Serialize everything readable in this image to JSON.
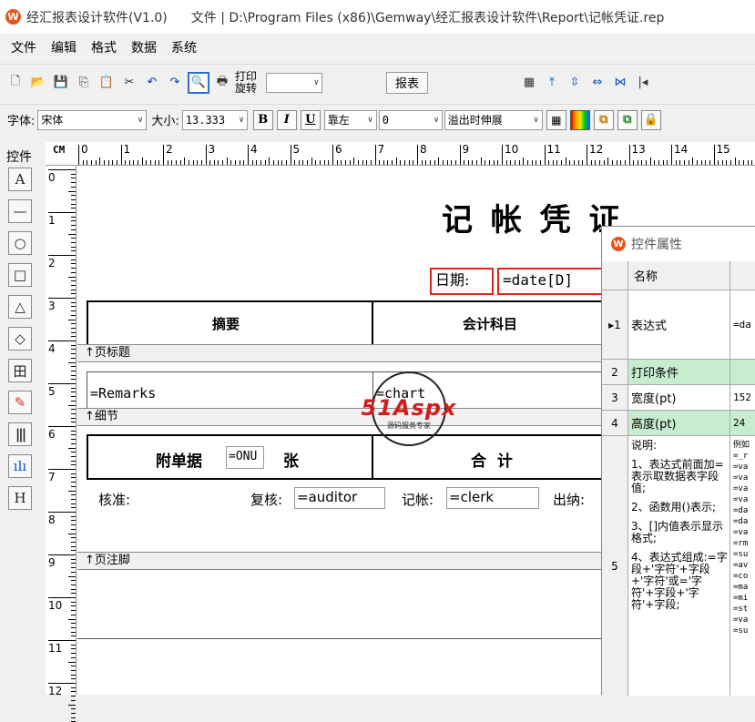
{
  "titlebar": {
    "app_name": "经汇报表设计软件(V1.0)",
    "file_label": "文件 | D:\\Program Files (x86)\\Gemway\\经汇报表设计软件\\Report\\记帐凭证.rep",
    "icon_text": "W"
  },
  "menu": [
    "文件",
    "编辑",
    "格式",
    "数据",
    "系统"
  ],
  "toolbar1": {
    "print_rotate_label": "打印旋转",
    "report_button": "报表",
    "combo_value": ""
  },
  "toolbar2": {
    "font_label": "字体:",
    "font_value": "宋体",
    "size_label": "大小:",
    "size_value": "13.333",
    "bold": "B",
    "italic": "I",
    "underline": "U",
    "align_value": "靠左",
    "indent_value": "0",
    "overflow_value": "溢出时伸展"
  },
  "palette": {
    "title": "控件",
    "items": [
      "A",
      "—",
      "○",
      "□",
      "△",
      "◇",
      "田",
      "✎",
      "|||",
      "ılı",
      "H"
    ]
  },
  "ruler": {
    "unit": "CM",
    "h_numbers": [
      "0",
      "1",
      "2",
      "3",
      "4",
      "5",
      "6",
      "7",
      "8",
      "9",
      "10",
      "11",
      "12",
      "13",
      "14",
      "15"
    ],
    "v_numbers": [
      "0",
      "1",
      "2",
      "3",
      "4",
      "5",
      "6",
      "7",
      "8",
      "9",
      "10",
      "11",
      "12"
    ]
  },
  "report": {
    "title": "记 帐 凭 证",
    "date_label": "日期:",
    "date_field": "=date[D]",
    "col_summary": "摘要",
    "col_account": "会计科目",
    "band_page_header": "↑页标题",
    "remarks_field": "=Remarks",
    "chart_field": "=chart",
    "band_detail": "↑细节",
    "attach_label": "附单据",
    "attach_field": "=ONU",
    "attach_unit": "张",
    "total_label": "合  计",
    "approve_label": "核准:",
    "review_label": "复核:",
    "auditor_field": "=auditor",
    "bookkeep_label": "记帐:",
    "clerk_field": "=clerk",
    "cashier_label": "出纳:",
    "band_page_footer": "↑页注脚"
  },
  "watermark": {
    "brand": "51Aspx",
    "sub": "源码服务专家"
  },
  "props": {
    "title": "控件属性",
    "header_name": "名称",
    "rows": [
      {
        "idx": "▸1",
        "name": "表达式",
        "value": "=da"
      },
      {
        "idx": "2",
        "name": "打印条件",
        "value": ""
      },
      {
        "idx": "3",
        "name": "宽度(pt)",
        "value": "152"
      },
      {
        "idx": "4",
        "name": "高度(pt)",
        "value": "24"
      }
    ],
    "desc_idx": "5",
    "desc_lines": [
      "说明:",
      "1、表达式前面加=表示取数据表字段值;",
      "2、函数用()表示;",
      "3、[]内值表示显示格式;",
      "4、表达式组成:=字段+'字符'+字段+'字符'或='字符'+字段+'字符'+字段;"
    ],
    "desc_values": [
      "例如",
      "=_r",
      "=va",
      "=va",
      "=va",
      "=va",
      "=da",
      "=da",
      "=va",
      "=rm",
      "=su",
      "=av",
      "=co",
      "=ma",
      "=mi",
      "=st",
      "=va",
      "=su"
    ]
  }
}
